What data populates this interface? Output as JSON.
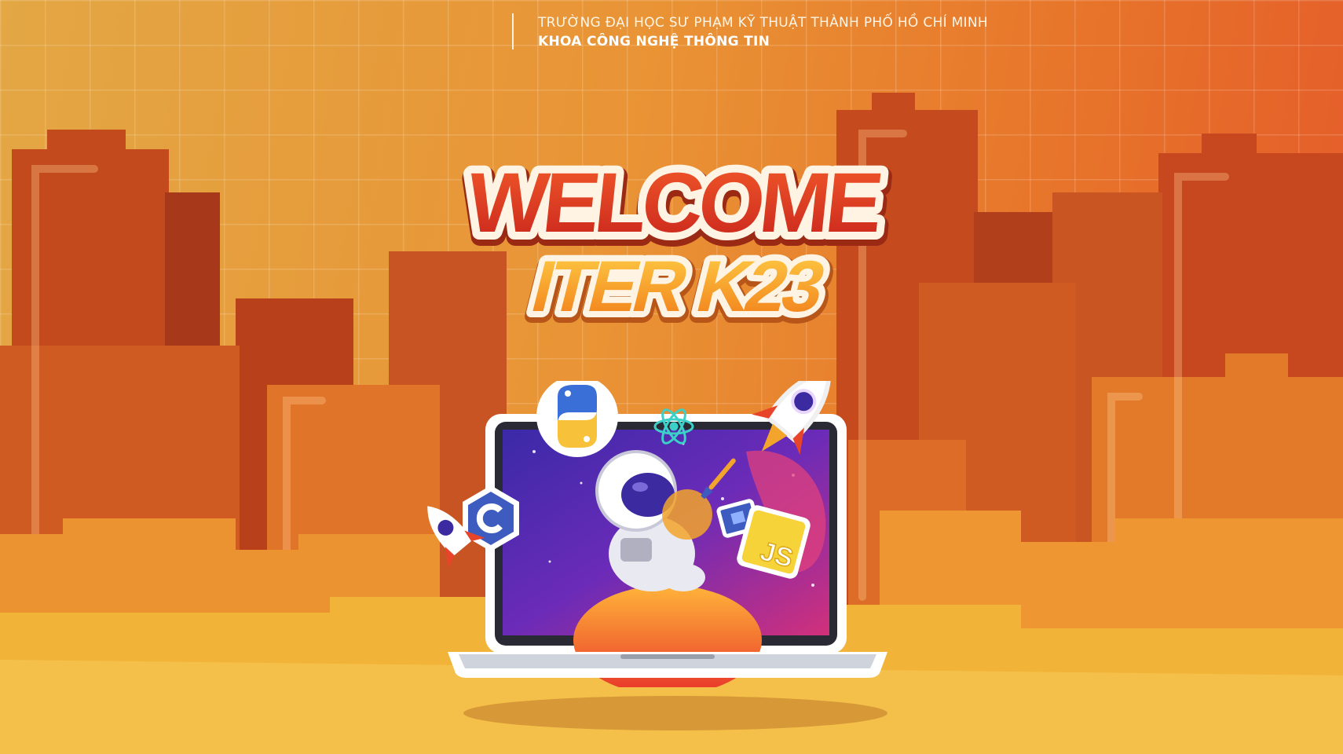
{
  "header": {
    "university": "TRƯỜNG ĐẠI HỌC SƯ PHẠM KỸ THUẬT THÀNH PHỐ HỒ CHÍ MINH",
    "faculty": "KHOA CÔNG NGHỆ THÔNG TIN"
  },
  "banner": {
    "welcome": "WELCOME",
    "cohort": "ITER K23",
    "js_sticker": "JS"
  },
  "colors": {
    "building_dark": "#b8401a",
    "building_mid": "#cf5a22",
    "building_light": "#e8882c",
    "front_yellow": "#f2b339",
    "title_red": "#e03a24",
    "title_orange": "#f39a1c",
    "screen_purple": "#4a2bb0"
  },
  "icons": [
    "python-icon",
    "react-icon",
    "csharp-icon",
    "javascript-icon",
    "rocket-icon",
    "astronaut-icon",
    "planet-icon",
    "notebook-icon",
    "paintbrush-icon"
  ]
}
